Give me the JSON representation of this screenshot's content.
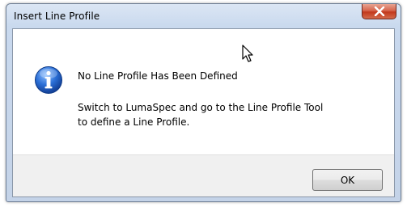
{
  "window": {
    "title": "Insert Line Profile"
  },
  "dialog": {
    "main_instruction": "No Line Profile Has Been Defined",
    "content_line1": "Switch to LumaSpec and go to the Line Profile Tool",
    "content_line2": "to define a Line Profile.",
    "icon": "info-icon"
  },
  "buttons": {
    "ok_label": "OK",
    "close_icon": "close-icon"
  },
  "colors": {
    "close_button": "#c2391d",
    "info_icon": "#2b6fd6"
  }
}
